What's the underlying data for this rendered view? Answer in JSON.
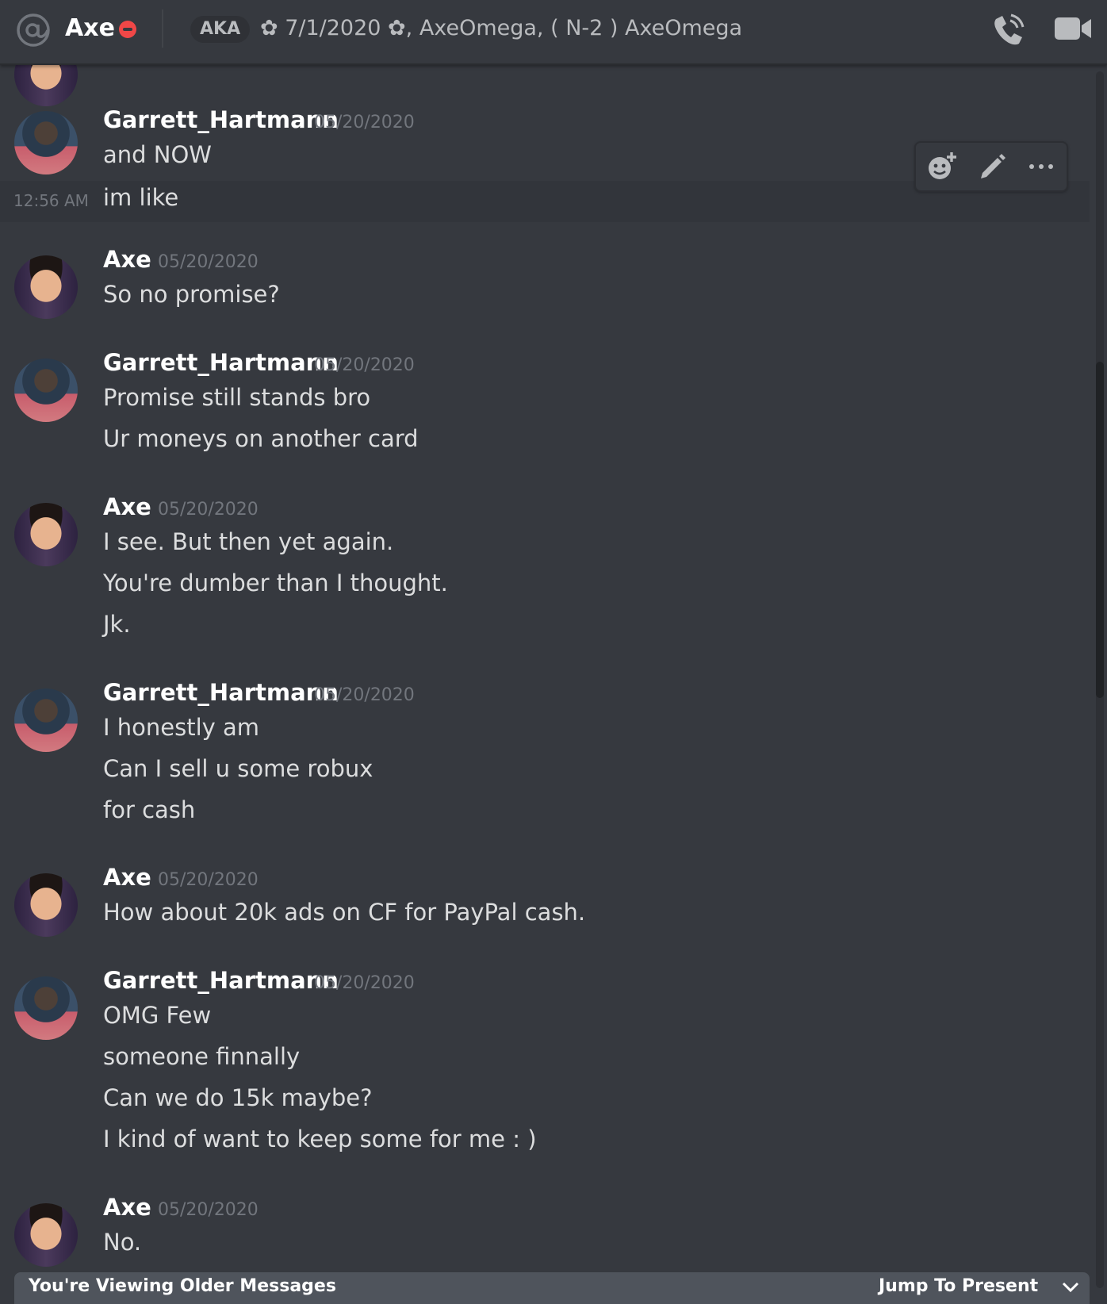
{
  "header": {
    "name": "Axe",
    "tag": "AKA",
    "topic": "✿ 7/1/2020 ✿, AxeOmega, ( N-2 ) AxeOmega"
  },
  "icons": [
    "at-icon",
    "dnd-status-icon",
    "call-icon",
    "video-icon",
    "add-reaction-icon",
    "edit-icon",
    "more-icon",
    "jump-arrow-icon"
  ],
  "colors": {
    "background": "#36393f",
    "status_dnd": "#f04747",
    "timestamp": "#72767d",
    "bar": "#4f545c"
  },
  "hover": {
    "time": "12:56 AM"
  },
  "messages": [
    {
      "author": "Garrett_Hartmann",
      "date": "05/20/2020",
      "lines": [
        "and NOW",
        "im like"
      ]
    },
    {
      "author": "Axe",
      "date": "05/20/2020",
      "lines": [
        "So no promise?"
      ]
    },
    {
      "author": "Garrett_Hartmann",
      "date": "05/20/2020",
      "lines": [
        "Promise still stands bro",
        "Ur moneys on another card"
      ]
    },
    {
      "author": "Axe",
      "date": "05/20/2020",
      "lines": [
        "I see. But then yet again.",
        "You're dumber than I thought.",
        "Jk."
      ]
    },
    {
      "author": "Garrett_Hartmann",
      "date": "05/20/2020",
      "lines": [
        "I honestly am",
        "Can I sell u some robux",
        "for cash"
      ]
    },
    {
      "author": "Axe",
      "date": "05/20/2020",
      "lines": [
        "How about 20k ads on CF for PayPal cash."
      ]
    },
    {
      "author": "Garrett_Hartmann",
      "date": "05/20/2020",
      "lines": [
        "OMG Few",
        "someone finnally",
        "Can we do 15k maybe?",
        "I kind of want to keep some for me : )"
      ]
    },
    {
      "author": "Axe",
      "date": "05/20/2020",
      "lines": [
        "No."
      ]
    }
  ],
  "footer": {
    "older": "You're Viewing Older Messages",
    "jump": "Jump To Present"
  }
}
